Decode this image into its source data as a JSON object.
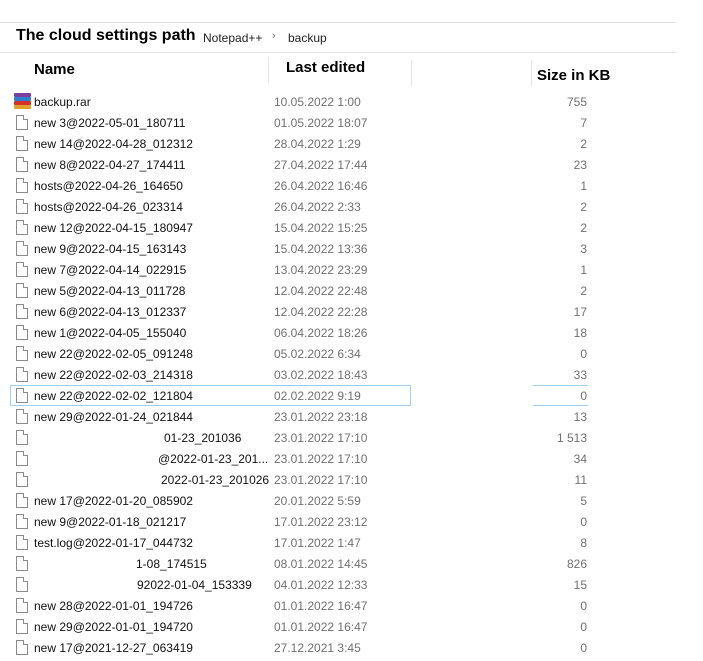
{
  "breadcrumb": {
    "title": "The cloud settings path",
    "segments": [
      "Notepad++",
      "backup"
    ],
    "separator": "›"
  },
  "columns": {
    "name": "Name",
    "date": "Last edited",
    "size": "Size in KB"
  },
  "files": [
    {
      "name": "backup.rar",
      "date": "10.05.2022 1:00",
      "size": "755",
      "icon": "rar-archive-icon"
    },
    {
      "name": "new 3@2022-05-01_180711",
      "date": "01.05.2022 18:07",
      "size": "7",
      "icon": "file-icon"
    },
    {
      "name": "new 14@2022-04-28_012312",
      "date": "28.04.2022 1:29",
      "size": "2",
      "icon": "file-icon"
    },
    {
      "name": "new 8@2022-04-27_174411",
      "date": "27.04.2022 17:44",
      "size": "23",
      "icon": "file-icon"
    },
    {
      "name": "hosts@2022-04-26_164650",
      "date": "26.04.2022 16:46",
      "size": "1",
      "icon": "file-icon"
    },
    {
      "name": "hosts@2022-04-26_023314",
      "date": "26.04.2022 2:33",
      "size": "2",
      "icon": "file-icon"
    },
    {
      "name": "new 12@2022-04-15_180947",
      "date": "15.04.2022 15:25",
      "size": "2",
      "icon": "file-icon"
    },
    {
      "name": "new 9@2022-04-15_163143",
      "date": "15.04.2022 13:36",
      "size": "3",
      "icon": "file-icon"
    },
    {
      "name": "new 7@2022-04-14_022915",
      "date": "13.04.2022 23:29",
      "size": "1",
      "icon": "file-icon"
    },
    {
      "name": "new 5@2022-04-13_011728",
      "date": "12.04.2022 22:48",
      "size": "2",
      "icon": "file-icon"
    },
    {
      "name": "new 6@2022-04-13_012337",
      "date": "12.04.2022 22:28",
      "size": "17",
      "icon": "file-icon"
    },
    {
      "name": "new 1@2022-04-05_155040",
      "date": "06.04.2022 18:26",
      "size": "18",
      "icon": "file-icon"
    },
    {
      "name": "new 22@2022-02-05_091248",
      "date": "05.02.2022 6:34",
      "size": "0",
      "icon": "file-icon"
    },
    {
      "name": "new 22@2022-02-03_214318",
      "date": "03.02.2022 18:43",
      "size": "33",
      "icon": "file-icon"
    },
    {
      "name": "new 22@2022-02-02_121804",
      "date": "02.02.2022 9:19",
      "size": "0",
      "icon": "file-icon",
      "selected": true
    },
    {
      "name": "new 29@2022-01-24_021844",
      "date": "23.01.2022 23:18",
      "size": "13",
      "icon": "file-icon"
    },
    {
      "name": "01-23_201036",
      "date": "23.01.2022 17:10",
      "size": "1 513",
      "icon": "file-icon",
      "offset": 130
    },
    {
      "name": "@2022-01-23_201...",
      "date": "23.01.2022 17:10",
      "size": "34",
      "icon": "file-icon",
      "offset": 124
    },
    {
      "name": "2022-01-23_201026",
      "date": "23.01.2022 17:10",
      "size": "11",
      "icon": "file-icon",
      "offset": 127
    },
    {
      "name": "new 17@2022-01-20_085902",
      "date": "20.01.2022 5:59",
      "size": "5",
      "icon": "file-icon"
    },
    {
      "name": "new 9@2022-01-18_021217",
      "date": "17.01.2022 23:12",
      "size": "0",
      "icon": "file-icon"
    },
    {
      "name": "test.log@2022-01-17_044732",
      "date": "17.01.2022 1:47",
      "size": "8",
      "icon": "file-icon"
    },
    {
      "name": "1-08_174515",
      "date": "08.01.2022 14:45",
      "size": "826",
      "icon": "file-icon",
      "offset": 102
    },
    {
      "name": "92022-01-04_153339",
      "date": "04.01.2022 12:33",
      "size": "15",
      "icon": "file-icon",
      "offset": 103
    },
    {
      "name": "new 28@2022-01-01_194726",
      "date": "01.01.2022 16:47",
      "size": "0",
      "icon": "file-icon"
    },
    {
      "name": "new 29@2022-01-01_194720",
      "date": "01.01.2022 16:47",
      "size": "0",
      "icon": "file-icon"
    },
    {
      "name": "new 17@2021-12-27_063419",
      "date": "27.12.2021 3:45",
      "size": "0",
      "icon": "file-icon"
    }
  ],
  "colors": {
    "selection_border": "#9fd0f0",
    "secondary_text": "#707070"
  }
}
